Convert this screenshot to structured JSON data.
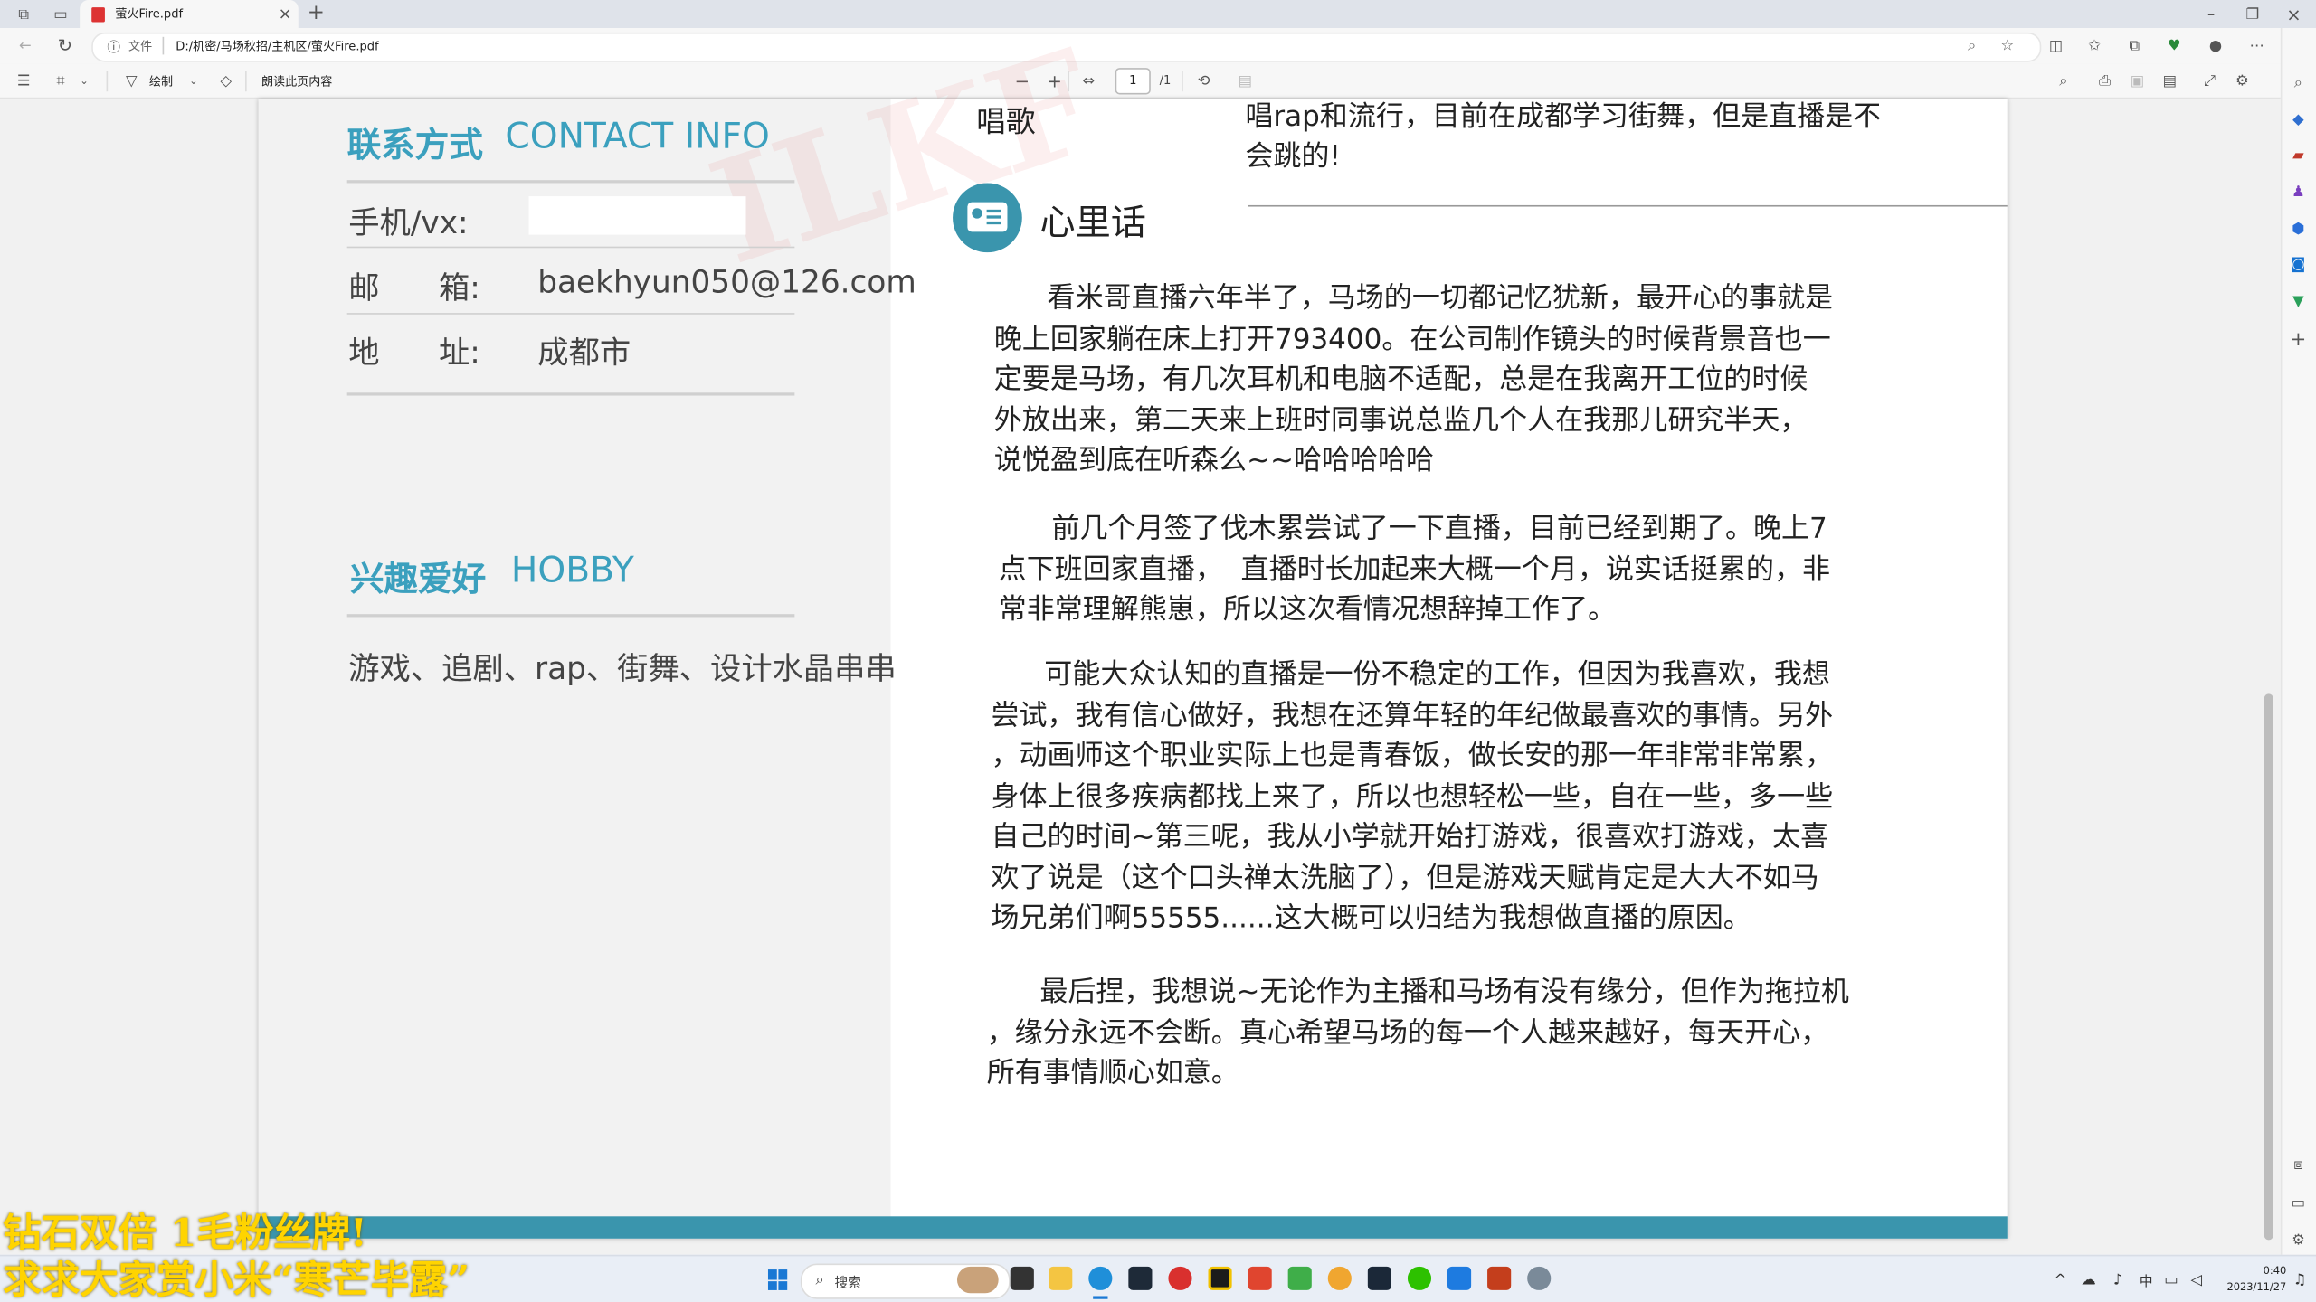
{
  "browser": {
    "tab_title": "萤火Fire.pdf",
    "url_scheme": "文件",
    "url": "D:/机密/马场秋招/主机区/萤火Fire.pdf"
  },
  "pdf_toolbar": {
    "draw_label": "绘制",
    "read_aloud_label": "朗读此页内容",
    "page_current": "1",
    "page_total": "/1"
  },
  "resume": {
    "contact": {
      "title_cn": "联系方式",
      "title_en": "CONTACT INFO",
      "phone_label": "手机/vx:",
      "email_label": "邮      箱:",
      "email": "baekhyun050@126.com",
      "address_label": "地      址:",
      "address": "成都市"
    },
    "hobby": {
      "title_cn": "兴趣爱好",
      "title_en": "HOBBY",
      "text": "游戏、追剧、rap、街舞、设计水晶串串"
    },
    "top_fragment": {
      "left": "唱歌",
      "right_line1": "唱rap和流行，目前在成都学习街舞，但是直播是不",
      "right_line2": "会跳的!"
    },
    "heart": {
      "title": "心里话",
      "p1": [
        "看米哥直播六年半了，马场的一切都记忆犹新，最开心的事就是",
        "晚上回家躺在床上打开793400。在公司制作镜头的时候背景音也一",
        "定要是马场，有几次耳机和电脑不适配，总是在我离开工位的时候",
        "外放出来，第二天来上班时同事说总监几个人在我那儿研究半天，",
        "说悦盈到底在听森么~~哈哈哈哈哈"
      ],
      "p2": [
        "前几个月签了伐木累尝试了一下直播，目前已经到期了。晚上7",
        "点下班回家直播，  直播时长加起来大概一个月，说实话挺累的，非",
        "常非常理解熊崽，所以这次看情况想辞掉工作了。"
      ],
      "p3": [
        "可能大众认知的直播是一份不稳定的工作，但因为我喜欢，我想",
        "尝试，我有信心做好，我想在还算年轻的年纪做最喜欢的事情。另外",
        "，动画师这个职业实际上也是青春饭，做长安的那一年非常非常累，",
        "身体上很多疾病都找上来了，所以也想轻松一些，自在一些，多一些",
        "自己的时间~第三呢，我从小学就开始打游戏，很喜欢打游戏，太喜",
        "欢了说是（这个口头禅太洗脑了），但是游戏天赋肯定是大大不如马",
        "场兄弟们啊55555......这大概可以归结为我想做直播的原因。"
      ],
      "p4": [
        "最后捏，我想说~无论作为主播和马场有没有缘分，但作为拖拉机",
        "，缘分永远不会断。真心希望马场的每一个人越来越好，每天开心，",
        "所有事情顺心如意。"
      ]
    }
  },
  "overlay": {
    "line1": "钻石双倍  1毛粉丝牌!",
    "line2": "求求大家赏小米“寒芒毕露”"
  },
  "taskbar": {
    "search_placeholder": "搜索",
    "time": "0:40",
    "date": "2023/11/27"
  },
  "colors": {
    "accent": "#3ba0be",
    "footer_bar": "#3a95ad",
    "overlay_text": "#ffd400"
  }
}
